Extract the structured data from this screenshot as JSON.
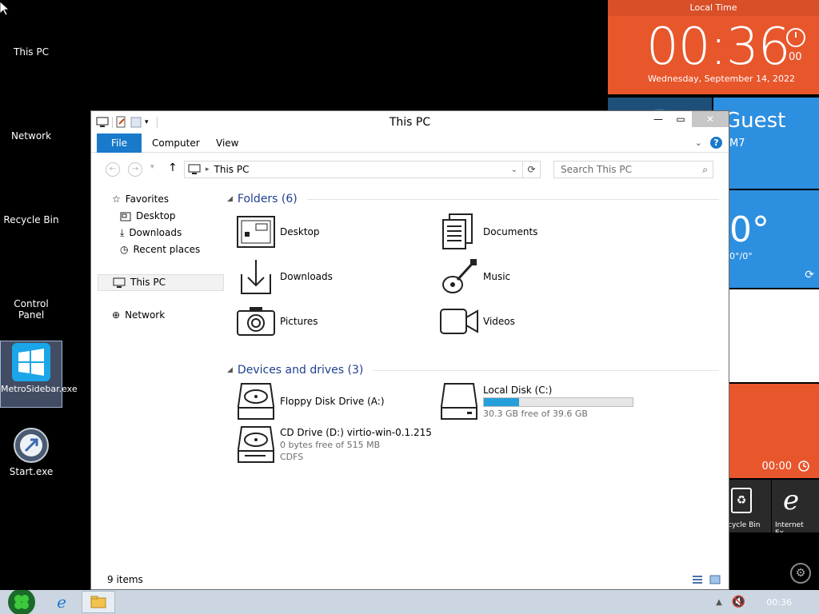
{
  "desktop": {
    "icons": [
      {
        "label": "This PC"
      },
      {
        "label": "Network"
      },
      {
        "label": "Recycle Bin"
      },
      {
        "label": "Control Panel"
      },
      {
        "label": "MetroSidebar.exe"
      },
      {
        "label": "Start.exe"
      }
    ]
  },
  "sidebar": {
    "clock_header": "Local Time",
    "time": "00:36",
    "seconds": "00",
    "date": "Wednesday, September 14, 2022",
    "user_name": "Guest",
    "user_sub": "M7",
    "weather_temp": "0°",
    "weather_range": "0°/0°",
    "alarm_time": "00:00",
    "recycle_label": "cycle Bin",
    "ie_label": "Internet Ex..."
  },
  "window": {
    "title": "This PC",
    "ribbon": {
      "file": "File",
      "computer": "Computer",
      "view": "View"
    },
    "address": "This PC",
    "search_placeholder": "Search This PC",
    "nav": {
      "favorites": "Favorites",
      "desktop": "Desktop",
      "downloads": "Downloads",
      "recent": "Recent places",
      "thispc": "This PC",
      "network": "Network"
    },
    "folders_header": "Folders (6)",
    "folders": [
      {
        "name": "Desktop",
        "icon": "desktop-folder-icon"
      },
      {
        "name": "Documents",
        "icon": "documents-folder-icon"
      },
      {
        "name": "Downloads",
        "icon": "downloads-folder-icon"
      },
      {
        "name": "Music",
        "icon": "music-folder-icon"
      },
      {
        "name": "Pictures",
        "icon": "pictures-folder-icon"
      },
      {
        "name": "Videos",
        "icon": "videos-folder-icon"
      }
    ],
    "drives_header": "Devices and drives (3)",
    "drives": {
      "floppy": {
        "name": "Floppy Disk Drive (A:)"
      },
      "local": {
        "name": "Local Disk (C:)",
        "free": "30.3 GB free of 39.6 GB",
        "used_fraction": 0.235
      },
      "cd": {
        "name": "CD Drive (D:) virtio-win-0.1.215",
        "free": "0 bytes free of 515 MB",
        "fs": "CDFS"
      }
    },
    "status": "9 items"
  },
  "taskbar": {
    "clock": "00:36"
  },
  "colors": {
    "accent": "#1979ca",
    "tile_orange": "#e8562c",
    "tile_blue": "#2d8fe0",
    "progress": "#26a0da"
  }
}
